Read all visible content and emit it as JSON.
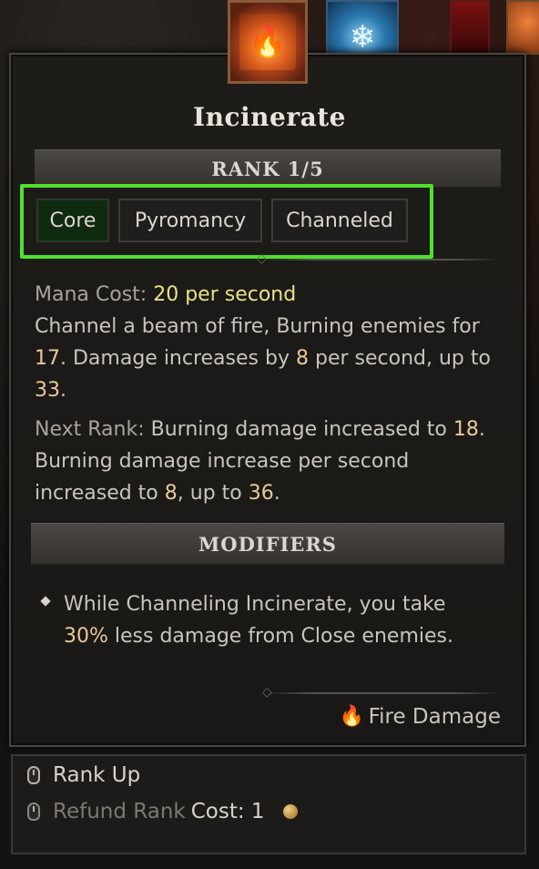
{
  "skill": {
    "name": "Incinerate",
    "rank": "RANK 1/5",
    "tags": [
      "Core",
      "Pyromancy",
      "Channeled"
    ],
    "description": {
      "mana_label": "Mana Cost:",
      "mana_value": "20 per second",
      "line1_a": "Channel a beam of fire, Burning enemies for",
      "val_burn": "17",
      "line2_a": ". Damage increases by ",
      "val_inc": "8",
      "line2_b": " per second, up to",
      "val_max": "33",
      "period": "."
    },
    "next_rank": {
      "label": "Next Rank:",
      "text_a": " Burning damage increased to ",
      "val_burn": "18",
      "period1": ".",
      "text_b": "Burning damage increase per second increased to ",
      "val_inc": "8",
      "text_c": ", up to ",
      "val_max": "36",
      "period2": "."
    },
    "modifiers_title": "MODIFIERS",
    "modifier": {
      "text_a": "While Channeling Incinerate, you take ",
      "val": "30%",
      "text_b": " less damage from Close enemies."
    },
    "damage_type": "Fire Damage"
  },
  "footer": {
    "rank_up": "Rank Up",
    "refund": "Refund Rank",
    "cost_label": "Cost: 1"
  },
  "colors": {
    "highlight_border": "#4ee12a",
    "value_text": "#e8c99a",
    "mana_text": "#e9e28a"
  },
  "icons": [
    "incinerate-skill-icon",
    "frost-skill-icon",
    "fire-icon",
    "mouse-icon",
    "coin-icon"
  ]
}
